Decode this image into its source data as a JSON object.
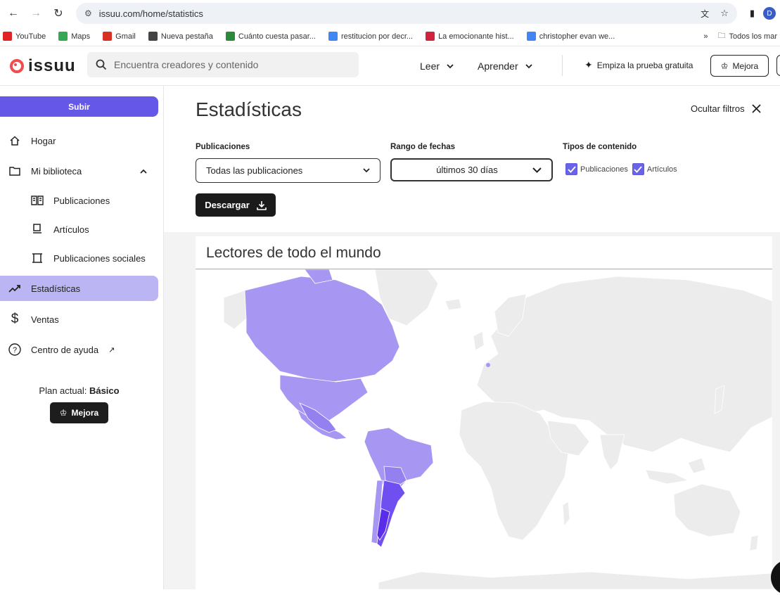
{
  "browser": {
    "url": "issuu.com/home/statistics",
    "profile_initial": "D",
    "bookmarks": [
      {
        "label": "YouTube",
        "icon": "youtube-icon",
        "color": "#e02424"
      },
      {
        "label": "Maps",
        "icon": "maps-icon",
        "color": "#34a853"
      },
      {
        "label": "Gmail",
        "icon": "gmail-icon",
        "color": "#d93025"
      },
      {
        "label": "Nueva pestaña",
        "icon": "chrome-icon",
        "color": "#444444"
      },
      {
        "label": "Cuánto cuesta pasar...",
        "icon": "pb-icon",
        "color": "#2c8a3a"
      },
      {
        "label": "restitucion por decr...",
        "icon": "google-icon",
        "color": "#4285f4"
      },
      {
        "label": "La emocionante hist...",
        "icon": "a-icon",
        "color": "#d0243c"
      },
      {
        "label": "christopher evan we...",
        "icon": "google-icon",
        "color": "#4285f4"
      }
    ],
    "more_bookmarks": "»",
    "all_bookmarks": "Todos los mar"
  },
  "header": {
    "logo_text": "issuu",
    "search_placeholder": "Encuentra creadores y contenido",
    "menu": [
      {
        "label": "Leer"
      },
      {
        "label": "Aprender"
      }
    ],
    "trial_label": "Empiza la prueba gratuita",
    "upgrade_label": "Mejora"
  },
  "sidebar": {
    "upload_label": "Subir",
    "items": [
      {
        "label": "Hogar",
        "icon": "home-icon"
      },
      {
        "label": "Mi biblioteca",
        "icon": "folder-icon"
      },
      {
        "label": "Publicaciones",
        "icon": "book-icon"
      },
      {
        "label": "Artículos",
        "icon": "article-icon"
      },
      {
        "label": "Publicaciones sociales",
        "icon": "social-post-icon"
      },
      {
        "label": "Estadísticas",
        "icon": "trend-icon"
      },
      {
        "label": "Ventas",
        "icon": "dollar-icon"
      },
      {
        "label": "Centro de ayuda",
        "icon": "help-icon"
      }
    ],
    "plan_prefix": "Plan actual: ",
    "plan_name": "Básico",
    "upgrade_label": "Mejora"
  },
  "main": {
    "title": "Estadísticas",
    "hide_filters": "Ocultar filtros",
    "publications_label": "Publicaciones",
    "publications_value": "Todas las publicaciones",
    "date_range_label": "Rango de fechas",
    "date_range_value": "últimos 30 días",
    "content_types_label": "Tipos de contenido",
    "content_types": [
      {
        "label": "Publicaciones",
        "checked": true
      },
      {
        "label": "Artículos",
        "checked": true
      }
    ],
    "download_label": "Descargar",
    "map_title": "Lectores de todo el mundo",
    "colors": {
      "accent": "#6558e8",
      "map_low": "#a897f2",
      "map_mid": "#9481ef",
      "map_high": "#6f4ff0",
      "map_top": "#5a2ee8",
      "map_none": "#ececec"
    }
  }
}
